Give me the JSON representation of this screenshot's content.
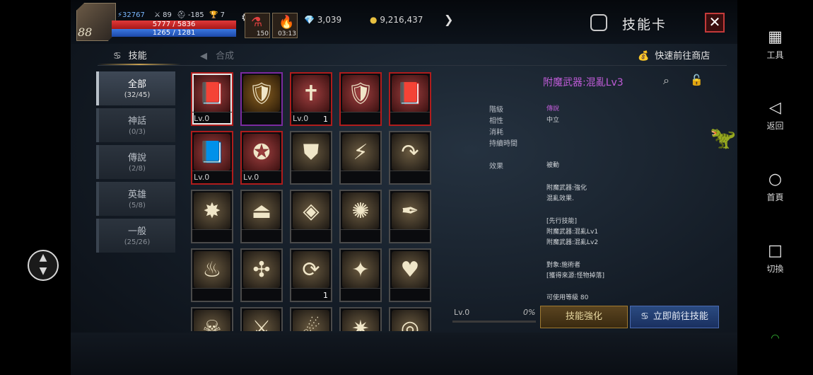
{
  "player": {
    "level": "88",
    "power": "32767",
    "stat1": "89",
    "stat2": "-185",
    "stat3": "7",
    "hp": "5777 / 5836",
    "mp": "1265 / 1281"
  },
  "slots": [
    {
      "count": "150"
    },
    {
      "count": "03:13"
    }
  ],
  "resources": {
    "gems": "3,039",
    "gold": "9,216,437"
  },
  "header": {
    "title": "技能卡"
  },
  "tabs": [
    {
      "label": "技能"
    },
    {
      "label": "合成"
    }
  ],
  "shop_link": "快速前往商店",
  "categories": [
    {
      "name": "全部",
      "count": "(32/45)"
    },
    {
      "name": "神話",
      "count": "(0/3)"
    },
    {
      "name": "傳說",
      "count": "(2/8)"
    },
    {
      "name": "英雄",
      "count": "(5/8)"
    },
    {
      "name": "一般",
      "count": "(25/26)"
    }
  ],
  "cards": [
    {
      "label": "Lv.0",
      "count": "",
      "icon": "📕",
      "rarity": "red"
    },
    {
      "label": "",
      "count": "",
      "icon": "🛡",
      "rarity": "purple"
    },
    {
      "label": "Lv.0",
      "count": "1",
      "icon": "✝",
      "rarity": "red"
    },
    {
      "label": "",
      "count": "",
      "icon": "🛡",
      "rarity": "red"
    },
    {
      "label": "",
      "count": "",
      "icon": "📕",
      "rarity": "red"
    },
    {
      "label": "Lv.0",
      "count": "",
      "icon": "📘",
      "rarity": "red"
    },
    {
      "label": "Lv.0",
      "count": "",
      "icon": "✪",
      "rarity": "red"
    },
    {
      "label": "",
      "count": "",
      "icon": "⛊",
      "rarity": "none"
    },
    {
      "label": "",
      "count": "",
      "icon": "⚡",
      "rarity": "none"
    },
    {
      "label": "",
      "count": "",
      "icon": "↷",
      "rarity": "none"
    },
    {
      "label": "",
      "count": "",
      "icon": "✸",
      "rarity": "none"
    },
    {
      "label": "",
      "count": "",
      "icon": "⏏",
      "rarity": "none"
    },
    {
      "label": "",
      "count": "",
      "icon": "◈",
      "rarity": "none"
    },
    {
      "label": "",
      "count": "",
      "icon": "✺",
      "rarity": "none"
    },
    {
      "label": "",
      "count": "",
      "icon": "✒",
      "rarity": "none"
    },
    {
      "label": "",
      "count": "",
      "icon": "♨",
      "rarity": "none"
    },
    {
      "label": "",
      "count": "",
      "icon": "✣",
      "rarity": "none"
    },
    {
      "label": "",
      "count": "1",
      "icon": "⟳",
      "rarity": "none"
    },
    {
      "label": "",
      "count": "",
      "icon": "✦",
      "rarity": "none"
    },
    {
      "label": "",
      "count": "",
      "icon": "♥",
      "rarity": "none"
    },
    {
      "label": "",
      "count": "",
      "icon": "☠",
      "rarity": "none"
    },
    {
      "label": "",
      "count": "",
      "icon": "⚔",
      "rarity": "none"
    },
    {
      "label": "",
      "count": "",
      "icon": "☄",
      "rarity": "none"
    },
    {
      "label": "",
      "count": "",
      "icon": "✷",
      "rarity": "none"
    },
    {
      "label": "",
      "count": "",
      "icon": "◎",
      "rarity": "none"
    }
  ],
  "detail": {
    "title": "附魔武器:混亂Lv3",
    "grade_label": "階級",
    "grade_value": "傳說",
    "affinity_label": "相性",
    "affinity_value": "中立",
    "cost_label": "消耗",
    "duration_label": "持續時間",
    "effect_label": "效果",
    "effect_value": "被動",
    "desc1": "附魔武器:強化",
    "desc2": "混亂效果.",
    "pre_header": "[先行技能]",
    "pre1": "附魔武器:混亂Lv1",
    "pre2": "附魔武器:混亂Lv2",
    "target": "對象:施術者",
    "source": "[獲得來源:怪物掉落]",
    "usable": "可使用等級 80"
  },
  "progress": {
    "level": "Lv.0",
    "percent": "0%",
    "fraction": 0
  },
  "buttons": {
    "enhance": "技能強化",
    "goto": "立即前往技能"
  },
  "nav": [
    {
      "label": "工具"
    },
    {
      "label": "返回"
    },
    {
      "label": "首頁"
    },
    {
      "label": "切換"
    }
  ]
}
